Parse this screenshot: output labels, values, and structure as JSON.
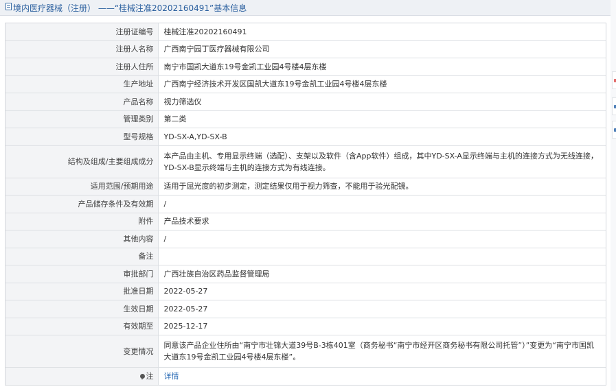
{
  "header": {
    "title": "境内医疗器械（注册） ——“桂械注准20202160491”基本信息",
    "icon": "document-icon"
  },
  "rows": [
    {
      "label": "注册证编号",
      "value": "桂械注准20202160491"
    },
    {
      "label": "注册人名称",
      "value": "广西南宁园丁医疗器械有限公司"
    },
    {
      "label": "注册人住所",
      "value": "南宁市国凯大道东19号金凯工业园4号楼4层东楼"
    },
    {
      "label": "生产地址",
      "value": "广西南宁经济技术开发区国凯大道东19号金凯工业园4号楼4层东楼"
    },
    {
      "label": "产品名称",
      "value": "视力筛选仪"
    },
    {
      "label": "管理类别",
      "value": "第二类"
    },
    {
      "label": "型号规格",
      "value": "YD-SX-A,YD-SX-B"
    },
    {
      "label": "结构及组成/主要组成成分",
      "value": "本产品由主机、专用显示终端（选配）、支架以及软件（含App软件）组成，其中YD-SX-A显示终端与主机的连接方式为无线连接，YD-SX-B显示终端与主机的连接方式为有线连接。"
    },
    {
      "label": "适用范围/预期用途",
      "value": "适用于屈光度的初步测定，测定结果仅用于视力筛查，不能用于验光配镜。"
    },
    {
      "label": "产品储存条件及有效期",
      "value": "/"
    },
    {
      "label": "附件",
      "value": "产品技术要求"
    },
    {
      "label": "其他内容",
      "value": "/"
    },
    {
      "label": "备注",
      "value": ""
    },
    {
      "label": "审批部门",
      "value": "广西壮族自治区药品监督管理局"
    },
    {
      "label": "批准日期",
      "value": "2022-05-27"
    },
    {
      "label": "生效日期",
      "value": "2022-05-27"
    },
    {
      "label": "有效期至",
      "value": "2025-12-17"
    },
    {
      "label": "变更情况",
      "value": "同意该产品企业住所由“南宁市壮锦大道39号B-3栋401室（商务秘书“南宁市经开区商务秘书有限公司托管”）”变更为“南宁市国凯大道东19号金凯工业园4号楼4层东楼”。"
    }
  ],
  "note": {
    "label": "注",
    "link_text": "详情",
    "icon": "pin-icon"
  },
  "colors": {
    "link": "#2a6bb5",
    "label_bg": "#f3f4f6",
    "title": "#2a5f9e"
  }
}
